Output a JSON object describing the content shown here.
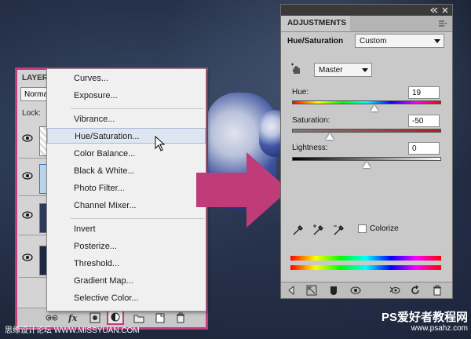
{
  "layers_panel": {
    "tab_label": "LAYER",
    "blend_mode": "Norma",
    "lock_label": "Lock:"
  },
  "adjustments_menu": {
    "items": [
      {
        "label": "Curves..."
      },
      {
        "label": "Exposure..."
      },
      {
        "label": "Vibrance..."
      },
      {
        "label": "Hue/Saturation..."
      },
      {
        "label": "Color Balance..."
      },
      {
        "label": "Black & White..."
      },
      {
        "label": "Photo Filter..."
      },
      {
        "label": "Channel Mixer..."
      },
      {
        "label": "Invert"
      },
      {
        "label": "Posterize..."
      },
      {
        "label": "Threshold..."
      },
      {
        "label": "Gradient Map..."
      },
      {
        "label": "Selective Color..."
      }
    ],
    "highlighted": "Hue/Saturation..."
  },
  "adjustments_panel": {
    "tab_label": "ADJUSTMENTS",
    "title": "Hue/Saturation",
    "preset": "Custom",
    "channel": "Master",
    "hue": {
      "label": "Hue:",
      "value": "19",
      "range": [
        -180,
        180
      ]
    },
    "saturation": {
      "label": "Saturation:",
      "value": "-50",
      "range": [
        -100,
        100
      ]
    },
    "lightness": {
      "label": "Lightness:",
      "value": "0",
      "range": [
        -100,
        100
      ]
    },
    "colorize_label": "Colorize",
    "colorize_checked": false
  },
  "watermarks": {
    "left": "思缘设计论坛 WWW.MISSYUAN.COM",
    "right_title": "PS爱好者教程网",
    "right_url": "www.psahz.com"
  },
  "colors": {
    "highlight_border": "#c43a7e",
    "arrow": "#bf3c78",
    "panel_gray": "#c9c9c9"
  }
}
